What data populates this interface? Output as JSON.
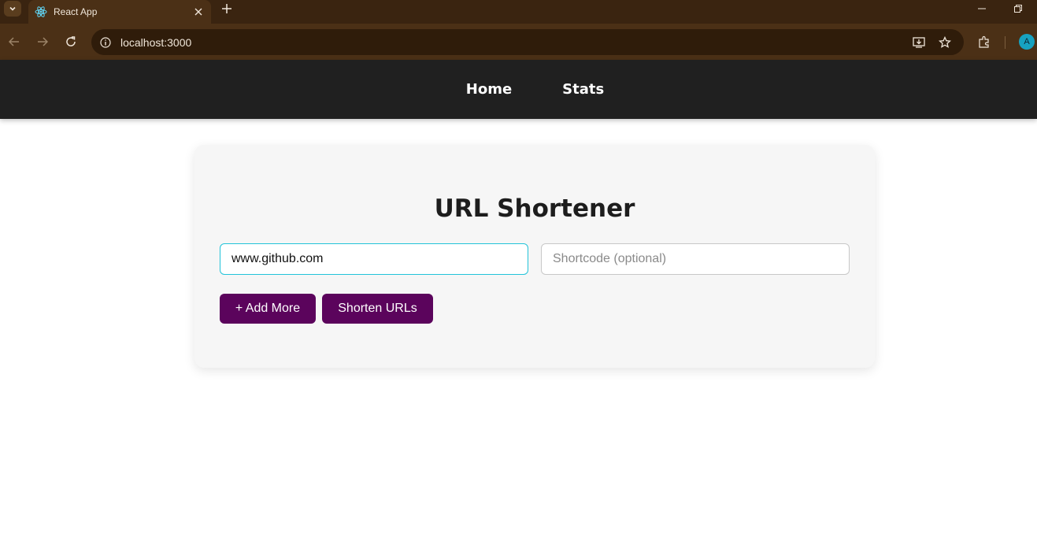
{
  "browser": {
    "tab_title": "React App",
    "url": "localhost:3000",
    "profile_initial": "A",
    "icons": [
      "tab-search-icon",
      "react-favicon-icon",
      "close-icon",
      "new-tab-icon",
      "minimize-icon",
      "restore-icon",
      "back-icon",
      "forward-icon",
      "reload-icon",
      "site-info-icon",
      "install-app-icon",
      "bookmark-star-icon",
      "extensions-icon"
    ]
  },
  "nav": {
    "items": [
      {
        "label": "Home"
      },
      {
        "label": "Stats"
      }
    ]
  },
  "main": {
    "title": "URL Shortener",
    "url_input": {
      "value": "www.github.com",
      "placeholder": ""
    },
    "shortcode_input": {
      "value": "",
      "placeholder": "Shortcode (optional)"
    },
    "add_more_label": "+ Add More",
    "shorten_label": "Shorten URLs"
  },
  "colors": {
    "accent_button": "#5b045c",
    "focus_border": "#22c3d9",
    "navbar_bg": "#202020",
    "browser_frame": "#4b3016"
  }
}
